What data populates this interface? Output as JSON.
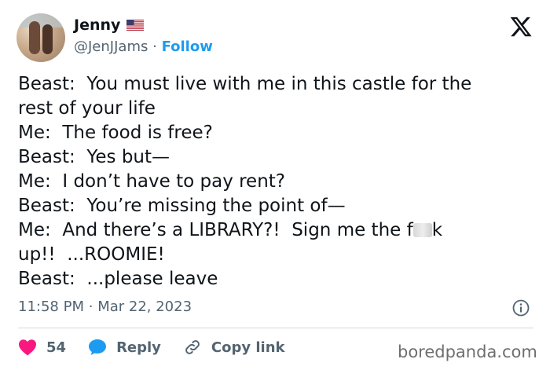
{
  "author": {
    "name": "Jenny",
    "handle": "@JenJJams",
    "separator": "·",
    "follow_label": "Follow",
    "flag_icon": "us-flag-icon"
  },
  "platform_icon": "x-logo-icon",
  "tweet": {
    "lines": [
      "Beast:  You must live with me in this castle for the",
      "rest of your life",
      "Me:  The food is free?",
      "Beast:  Yes but—",
      "Me:  I don’t have to pay rent?",
      "Beast:  You’re missing the point of—",
      "Me:  And there’s a LIBRARY?!  Sign me the f",
      "k",
      "up!!  ...ROOMIE!",
      "Beast:  ...please leave"
    ]
  },
  "meta": {
    "time": "11:58 PM",
    "separator": "·",
    "date": "Mar 22, 2023"
  },
  "actions": {
    "likes_count": "54",
    "reply_label": "Reply",
    "copy_link_label": "Copy link"
  },
  "colors": {
    "accent": "#1d9bf0",
    "like": "#f91880",
    "text": "#0f1419",
    "muted": "#536471"
  },
  "watermark": "boredpanda.com"
}
